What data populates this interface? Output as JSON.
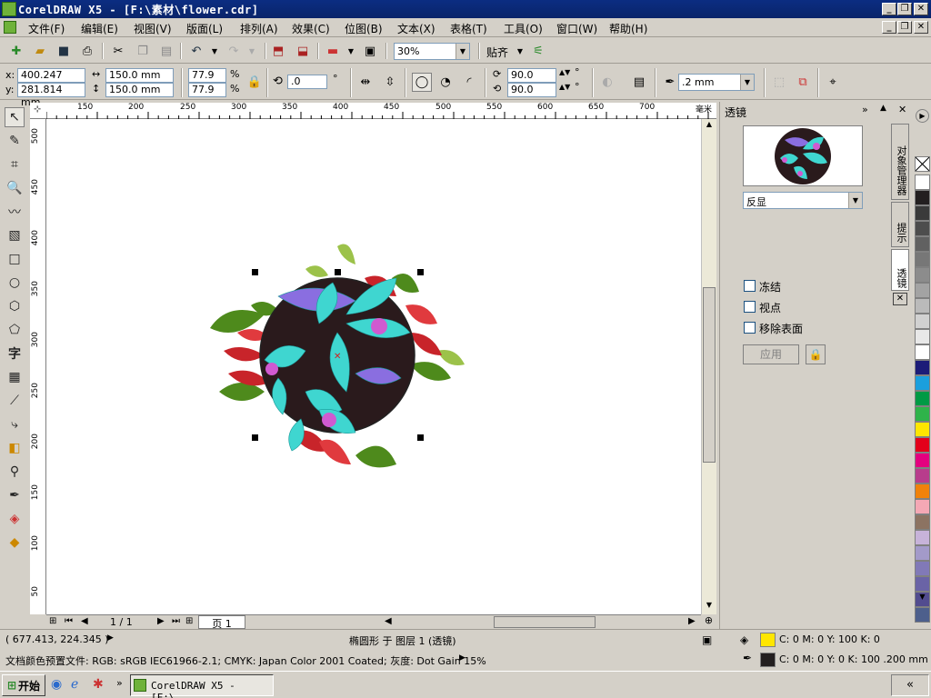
{
  "window": {
    "title": "CorelDRAW X5 - [F:\\素材\\flower.cdr]"
  },
  "menu": [
    "文件(F)",
    "编辑(E)",
    "视图(V)",
    "版面(L)",
    "排列(A)",
    "效果(C)",
    "位图(B)",
    "文本(X)",
    "表格(T)",
    "工具(O)",
    "窗口(W)",
    "帮助(H)"
  ],
  "toolbar": {
    "zoom": "30%",
    "snap": "贴齐"
  },
  "properties": {
    "x": "400.247 mm",
    "y": "281.814 mm",
    "width": "150.0 mm",
    "height": "150.0 mm",
    "scale_w": "77.9",
    "scale_h": "77.9",
    "percent": "%",
    "rotation": ".0",
    "degree": "°",
    "start_angle": "90.0",
    "end_angle": "90.0",
    "outline": ".2 mm",
    "x_label": "x:",
    "y_label": "y:"
  },
  "rulers": {
    "h": [
      "150",
      "200",
      "250",
      "300",
      "350",
      "400",
      "450",
      "500",
      "550",
      "600",
      "650",
      "700"
    ],
    "h_unit": "毫米",
    "v": [
      "500",
      "450",
      "400",
      "350",
      "300",
      "250",
      "200",
      "150",
      "100",
      "50"
    ]
  },
  "page_nav": {
    "count": "1 / 1",
    "tab": "页 1"
  },
  "docker": {
    "title": "透镜",
    "lens_type": "反显",
    "freeze": "冻结",
    "viewpoint": "视点",
    "remove_face": "移除表面",
    "apply": "应用"
  },
  "side_tabs": [
    "对象管理器",
    "提示",
    "透镜"
  ],
  "palette": [
    "#ffffff",
    "#231f20",
    "#3a3a3a",
    "#4d4d4d",
    "#616161",
    "#777777",
    "#8c8c8c",
    "#a3a3a3",
    "#bababa",
    "#d1d1d1",
    "#e8e8e8",
    "#ffffff",
    "#1c1c78",
    "#1b9fdd",
    "#009a45",
    "#2fb34a",
    "#ffe600",
    "#e3001b",
    "#e4007f",
    "#b83c8c",
    "#f0820a",
    "#f5a8b5",
    "#8c7362",
    "#c7b3d9",
    "#a39ac9",
    "#8179b7",
    "#6a63a6",
    "#524c8f",
    "#4d5f8c"
  ],
  "status": {
    "cursor": "( 677.413, 224.345 )",
    "object": "椭圆形 于 图层 1 (透镜)",
    "doc_profile": "文档颜色预置文件: RGB: sRGB IEC61966-2.1; CMYK: Japan Color 2001 Coated; 灰度: Dot Gain 15%",
    "fill": "C: 0 M: 0 Y: 100 K: 0",
    "outline": "C: 0 M: 0 Y: 0 K: 100  .200 mm",
    "fill_color": "#ffe600",
    "outline_color": "#231f20"
  },
  "taskbar": {
    "start": "开始",
    "task": "CorelDRAW X5 - [F:\\...",
    "tray": "«"
  }
}
